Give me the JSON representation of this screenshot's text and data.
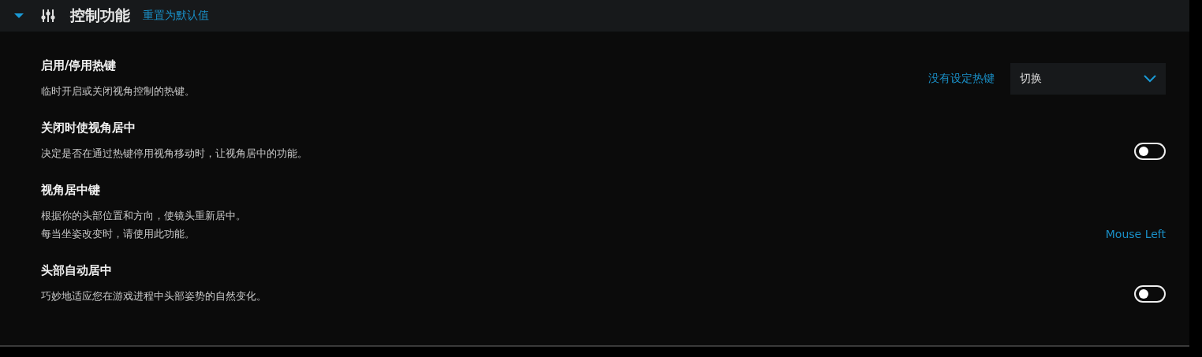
{
  "section": {
    "title": "控制功能",
    "reset_link": "重置为默认值",
    "expanded": true
  },
  "settings": [
    {
      "kind": "hotkey",
      "title": "启用/停用热键",
      "description": [
        "临时开启或关闭视角控制的热键。"
      ],
      "hotkey_link": "没有设定热键",
      "dropdown_value": "切换"
    },
    {
      "kind": "toggle",
      "title": "关闭时使视角居中",
      "description": [
        "决定是否在通过热键停用视角移动时，让视角居中的功能。"
      ],
      "on": false
    },
    {
      "kind": "key",
      "title": "视角居中键",
      "description": [
        "根据你的头部位置和方向，使镜头重新居中。",
        "每当坐姿改变时，请使用此功能。"
      ],
      "key_link": "Mouse Left"
    },
    {
      "kind": "toggle",
      "title": "头部自动居中",
      "description": [
        "巧妙地适应您在游戏进程中头部姿势的自然变化。"
      ],
      "on": false
    }
  ]
}
